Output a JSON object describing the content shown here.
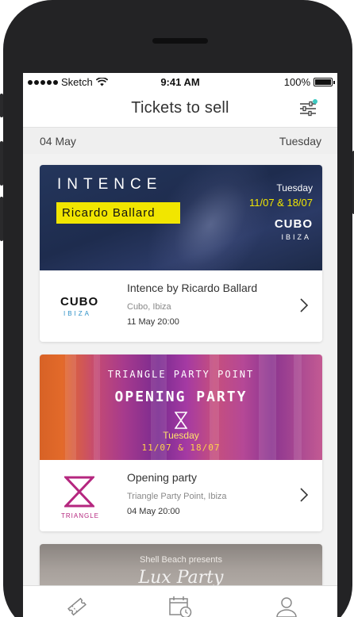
{
  "status_bar": {
    "carrier": "Sketch",
    "time": "9:41 AM",
    "battery": "100%"
  },
  "nav": {
    "title": "Tickets to sell",
    "filter_badge_color": "#3cc9c0"
  },
  "date_row": {
    "date": "04 May",
    "weekday": "Tuesday"
  },
  "events": [
    {
      "banner": {
        "title": "INTENCE",
        "artist": "Ricardo Ballard",
        "day": "Tuesday",
        "dates": "11/07 & 18/07",
        "brand": "CUBO",
        "brand_sub": "IBIZA"
      },
      "logo": {
        "name": "CUBO",
        "sub": "IBIZA"
      },
      "title": "Intence by Ricardo Ballard",
      "venue": "Cubo, Ibiza",
      "date": "11 May 20:00"
    },
    {
      "banner": {
        "top": "TRIANGLE PARTY POINT",
        "main": "OPENING PARTY",
        "day": "Tuesday",
        "dates": "11/07 & 18/07"
      },
      "logo": {
        "name": "TRIANGLE"
      },
      "title": "Opening party",
      "venue": "Triangle Party Point, Ibiza",
      "date": "04 May 20:00"
    },
    {
      "banner": {
        "pre": "Shell Beach presents",
        "title": "Lux Party"
      }
    }
  ],
  "tabbar": {
    "items": [
      {
        "icon": "ticket-icon"
      },
      {
        "icon": "calendar-clock-icon"
      },
      {
        "icon": "user-icon"
      }
    ]
  },
  "colors": {
    "accent_yellow": "#f1e600",
    "cubo_blue": "#2b8fc6",
    "triangle_magenta": "#b5277f",
    "background": "#f2f2f2"
  }
}
